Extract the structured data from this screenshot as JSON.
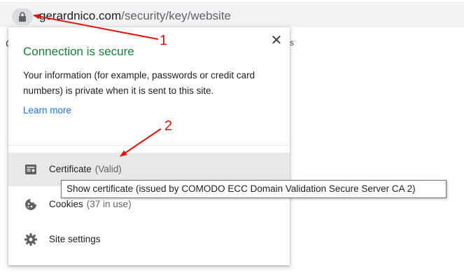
{
  "address_bar": {
    "url_domain": "gerardnico.com",
    "url_path": "/security/key/website"
  },
  "background": {
    "left_fragment": "G",
    "right_fragment": "s"
  },
  "popup": {
    "title": "Connection is secure",
    "description": "Your information (for example, passwords or credit card numbers) is private when it is sent to this site.",
    "learn_more": "Learn more",
    "close_label": "✕",
    "items": [
      {
        "label": "Certificate",
        "sublabel": "(Valid)",
        "icon": "certificate-icon"
      },
      {
        "label": "Cookies",
        "sublabel": "(37 in use)",
        "icon": "cookie-icon"
      },
      {
        "label": "Site settings",
        "sublabel": "",
        "icon": "gear-icon"
      }
    ]
  },
  "tooltip": {
    "text": "Show certificate (issued by COMODO ECC Domain Validation Secure Server CA 2)"
  },
  "annotations": {
    "label_1": "1",
    "label_2": "2",
    "color": "#e0120a"
  },
  "colors": {
    "secure_green": "#188038",
    "link_blue": "#1a73e8",
    "hover_gray": "#e8e8e8"
  }
}
